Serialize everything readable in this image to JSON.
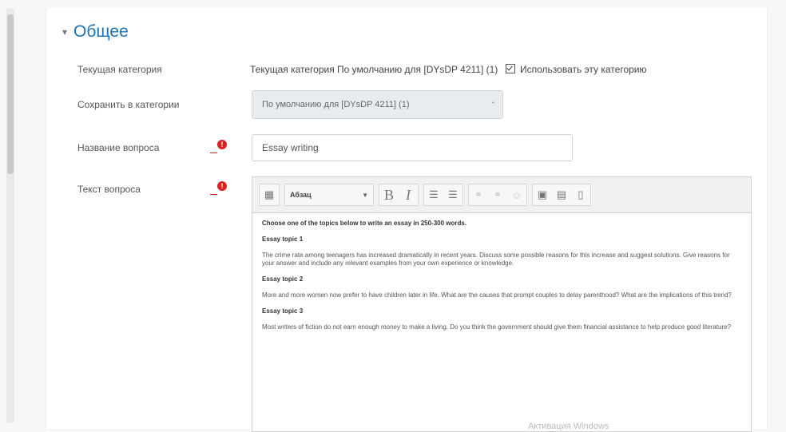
{
  "section": {
    "title": "Общее",
    "chevron": "chevron-down-icon"
  },
  "fields": {
    "current_category": {
      "label": "Текущая категория",
      "value": "Текущая категория По умолчанию для [DYsDP 4211] (1)",
      "checkbox_label": "Использовать эту категорию",
      "checkbox_checked": true
    },
    "save_in_category": {
      "label": "Сохранить в категории",
      "selected": "По умолчанию для [DYsDP 4211] (1)"
    },
    "question_name": {
      "label": "Название вопроса",
      "value": "Essay writing",
      "required_icon": "exclamation-icon"
    },
    "question_text": {
      "label": "Текст вопроса",
      "required_icon": "exclamation-icon"
    }
  },
  "editor": {
    "toolbar": {
      "paragraph_label": "Абзац",
      "buttons": [
        "toggle-toolbar",
        "bold",
        "italic",
        "unordered-list",
        "ordered-list",
        "link",
        "unlink",
        "emoticon",
        "image",
        "media",
        "manage-files"
      ]
    },
    "content": {
      "intro": "Choose one of the topics below to write an essay in 250-300 words.",
      "topic1_title": "Essay topic 1",
      "topic1_text": "The crime rate among teenagers has increased dramatically in recent years. Discuss some possible reasons for this increase and suggest solutions. Give reasons for your answer and include any relevant examples from your own experience or knowledge.",
      "topic2_title": "Essay topic 2",
      "topic2_text": "More and more women now prefer to have children later in life. What are the causes that prompt couples to delay parenthood? What are the implications of this trend?",
      "topic3_title": "Essay topic 3",
      "topic3_text": "Most writers of fiction do not earn enough money to make a living. Do you think the government should give them financial assistance to help produce good literature?"
    }
  },
  "watermark": "Активация Windows"
}
